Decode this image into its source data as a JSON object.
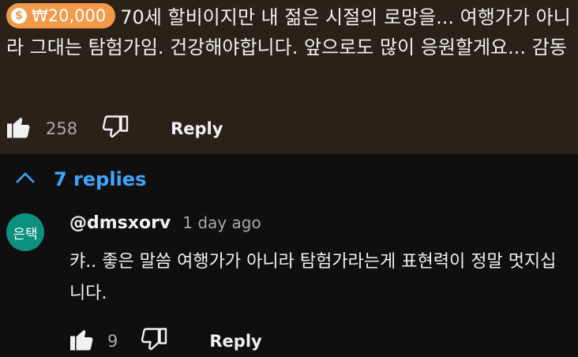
{
  "comment": {
    "super_thanks_amount": "₩20,000",
    "super_thanks_icon": "dollar-coin-heart-icon",
    "text": "70세 할비이지만 내 젊은 시절의 로망을... 여행가가 아니라 그대는 탐험가임. 건강해야합니다. 앞으로도 많이 응원할게요... 감동",
    "like_count": "258",
    "reply_label": "Reply"
  },
  "replies_toggle": {
    "label": "7 replies",
    "icon": "chevron-up-icon"
  },
  "reply": {
    "avatar_text": "은택",
    "author": "@dmsxorv",
    "time": "1 day ago",
    "text": "캬.. 좋은 말씀 여행가가 아니라 탐험가라는게 표현력이 정말 멋지십니다.",
    "like_count": "9",
    "reply_label": "Reply"
  },
  "colors": {
    "accent_blue": "#3ea6ff",
    "badge_orange": "#f2994a",
    "avatar_teal": "#0b8f7f",
    "top_background": "#2a2118"
  }
}
